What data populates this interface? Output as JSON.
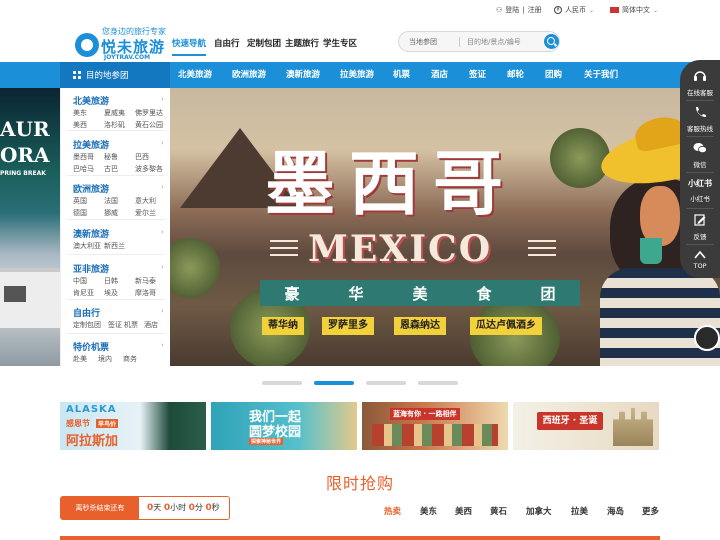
{
  "topbar": {
    "login": "登陆",
    "sep": "|",
    "register": "注册",
    "currency": "人民币",
    "language": "简体中文"
  },
  "logo": {
    "slogan": "您身边的旅行专家",
    "name": "悦未旅游",
    "url": "JOYTRAV.COM"
  },
  "quicknav": {
    "items": [
      "快速导航",
      "自由行",
      "定制包团",
      "主题旅行",
      "学生专区"
    ]
  },
  "search": {
    "location": "当地参团",
    "placeholder": "目的地/景点/编号"
  },
  "navbar": {
    "destinations_label": "目的地参团",
    "items": [
      "北美旅游",
      "欧洲旅游",
      "澳新旅游",
      "拉美旅游",
      "机票",
      "酒店",
      "签证",
      "邮轮",
      "团购",
      "关于我们"
    ]
  },
  "destmenu": [
    {
      "title": "北美旅游",
      "cities": [
        [
          "美东",
          "夏威夷",
          "佛罗里达"
        ],
        [
          "美西",
          "洛杉矶",
          "黄石公园"
        ]
      ]
    },
    {
      "title": "拉美旅游",
      "cities": [
        [
          "墨西哥",
          "秘鲁",
          "巴西"
        ],
        [
          "巴哈马",
          "古巴",
          "波多黎各"
        ]
      ]
    },
    {
      "title": "欧洲旅游",
      "cities": [
        [
          "英国",
          "法国",
          "意大利"
        ],
        [
          "德国",
          "挪威",
          "爱尔兰"
        ]
      ]
    },
    {
      "title": "澳新旅游",
      "cities": [
        [
          "澳大利亚",
          "新西兰"
        ]
      ]
    },
    {
      "title": "亚非旅游",
      "cities": [
        [
          "中国",
          "日韩",
          "新马泰"
        ],
        [
          "肯尼亚",
          "埃及",
          "摩洛哥"
        ]
      ]
    },
    {
      "title": "自由行",
      "cities": [
        [
          "定制包团",
          "签证",
          "机票",
          "酒店"
        ]
      ]
    },
    {
      "title": "特价机票",
      "cities": [
        [
          "赴美",
          "境内",
          "商务"
        ]
      ]
    }
  ],
  "hero": {
    "left_text_1": "AUR",
    "left_text_2": "ORA",
    "left_sub": "PRING BREAK",
    "title": "墨西哥",
    "subtitle": "MEXICO",
    "ribbon": [
      "豪",
      "华",
      "美",
      "食",
      "团"
    ],
    "tags": [
      "蒂华纳",
      "罗萨里多",
      "恩森纳达",
      "瓜达卢佩酒乡"
    ]
  },
  "floatbar": {
    "items": [
      "在线客服",
      "客服热线",
      "微信",
      "小红书",
      "反馈",
      "TOP"
    ],
    "xhs_logo": "小红书"
  },
  "carousel": {
    "count": 4,
    "active": 1
  },
  "promos": [
    {
      "line1": "ALASKA",
      "line2": "感恩节",
      "line3": "阿拉斯加",
      "badge": "早鸟价"
    },
    {
      "line1": "我们一起",
      "line2": "圆梦校园",
      "line3": "探索神秘世界"
    },
    {
      "line1": "蓝海有你 · 一路相伴",
      "line2": ""
    },
    {
      "line1": "西班牙 · 圣诞"
    }
  ],
  "flash_sale": {
    "title": "限时抢购",
    "countdown_label": "离秒杀结束还有",
    "days": "0",
    "days_unit": "天",
    "hours": "0",
    "hours_unit": "小时",
    "minutes": "0",
    "minutes_unit": "分",
    "seconds": "0",
    "seconds_unit": "秒",
    "tabs": [
      "热卖",
      "美东",
      "美西",
      "黄石",
      "加拿大",
      "拉美",
      "海岛",
      "更多"
    ]
  },
  "colors": {
    "brand_blue": "#1b8fd8",
    "accent_orange": "#e8602c"
  }
}
